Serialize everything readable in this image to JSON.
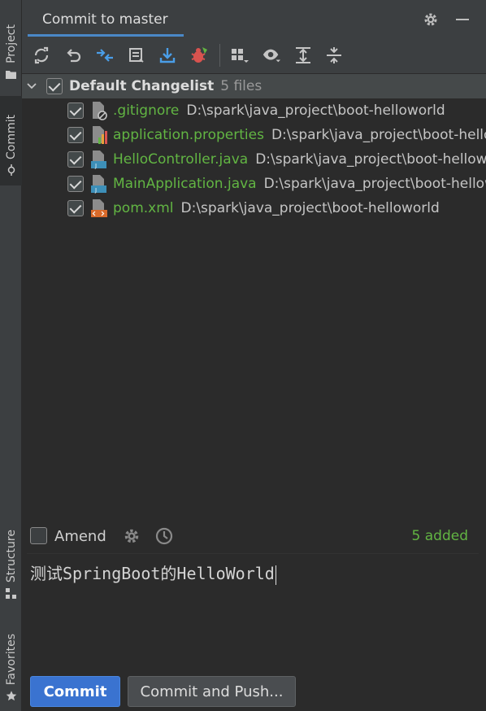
{
  "sidebar": {
    "project_label": "Project",
    "commit_label": "Commit",
    "structure_label": "Structure",
    "favorites_label": "Favorites"
  },
  "header": {
    "title": "Commit to master"
  },
  "toolbar": {
    "buttons": [
      {
        "icon": "refresh-icon"
      },
      {
        "icon": "rollback-icon"
      },
      {
        "icon": "diff-icon"
      },
      {
        "icon": "shelve-icon"
      },
      {
        "icon": "update-icon"
      },
      {
        "icon": "bug-icon"
      },
      {
        "icon": "group-by-icon"
      },
      {
        "icon": "eye-icon"
      },
      {
        "icon": "expand-all-icon"
      },
      {
        "icon": "collapse-all-icon"
      }
    ]
  },
  "changelist": {
    "name": "Default Changelist",
    "count": "5 files",
    "files": [
      {
        "name": ".gitignore",
        "path": "D:\\spark\\java_project\\boot-helloworld",
        "icon": "ignore-file-icon"
      },
      {
        "name": "application.properties",
        "path": "D:\\spark\\java_project\\boot-helloworld",
        "icon": "properties-file-icon"
      },
      {
        "name": "HelloController.java",
        "path": "D:\\spark\\java_project\\boot-helloworld",
        "icon": "java-file-icon"
      },
      {
        "name": "MainApplication.java",
        "path": "D:\\spark\\java_project\\boot-helloworld",
        "icon": "java-file-icon"
      },
      {
        "name": "pom.xml",
        "path": "D:\\spark\\java_project\\boot-helloworld",
        "icon": "xml-file-icon"
      }
    ]
  },
  "amend": {
    "label": "Amend",
    "status": "5 added"
  },
  "message": {
    "text": "测试SpringBoot的HelloWorld"
  },
  "actions": {
    "commit_label": "Commit",
    "commit_push_label": "Commit and Push..."
  },
  "colors": {
    "accent": "#3a73d0",
    "added": "#62b543",
    "panel_bg": "#2b2b2b",
    "toolbar_bg": "#3c3f41"
  }
}
